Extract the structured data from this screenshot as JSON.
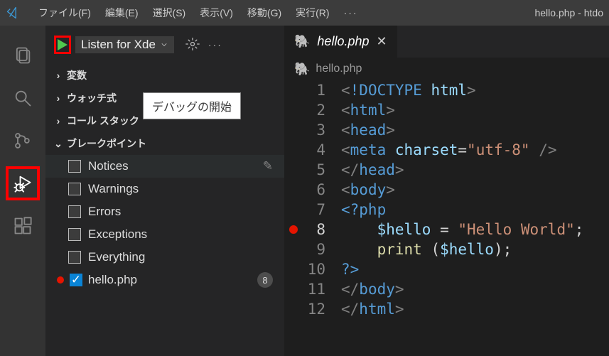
{
  "window_title": "hello.php - htdo",
  "menubar": [
    "ファイル(F)",
    "編集(E)",
    "選択(S)",
    "表示(V)",
    "移動(G)",
    "実行(R)"
  ],
  "sidebar": {
    "config_label": "Listen for Xde",
    "tooltip": "デバッグの開始",
    "sections": {
      "variables": "変数",
      "watch": "ウォッチ式",
      "callstack": "コール スタック",
      "breakpoints": "ブレークポイント"
    },
    "breakpoints": [
      {
        "label": "Notices",
        "checked": false
      },
      {
        "label": "Warnings",
        "checked": false
      },
      {
        "label": "Errors",
        "checked": false
      },
      {
        "label": "Exceptions",
        "checked": false
      },
      {
        "label": "Everything",
        "checked": false
      }
    ],
    "file_bp": {
      "label": "hello.php",
      "count": "8"
    }
  },
  "editor": {
    "tab_label": "hello.php",
    "breadcrumb": "hello.php",
    "breakpoint_line": 8,
    "current_line": 8,
    "lines": [
      {
        "n": 1,
        "tokens": [
          [
            "<",
            "ang"
          ],
          [
            "!DOCTYPE ",
            "tag"
          ],
          [
            "html",
            "attr"
          ],
          [
            ">",
            "ang"
          ]
        ]
      },
      {
        "n": 2,
        "tokens": [
          [
            "<",
            "ang"
          ],
          [
            "html",
            "tag"
          ],
          [
            ">",
            "ang"
          ]
        ]
      },
      {
        "n": 3,
        "tokens": [
          [
            "<",
            "ang"
          ],
          [
            "head",
            "tag"
          ],
          [
            ">",
            "ang"
          ]
        ]
      },
      {
        "n": 4,
        "tokens": [
          [
            "<",
            "ang"
          ],
          [
            "meta ",
            "tag"
          ],
          [
            "charset",
            "attr"
          ],
          [
            "=",
            "txt"
          ],
          [
            "\"utf-8\"",
            "str"
          ],
          [
            " />",
            "ang"
          ]
        ]
      },
      {
        "n": 5,
        "tokens": [
          [
            "</",
            "ang"
          ],
          [
            "head",
            "tag"
          ],
          [
            ">",
            "ang"
          ]
        ]
      },
      {
        "n": 6,
        "tokens": [
          [
            "<",
            "ang"
          ],
          [
            "body",
            "tag"
          ],
          [
            ">",
            "ang"
          ]
        ]
      },
      {
        "n": 7,
        "tokens": [
          [
            "<?php",
            "tag"
          ]
        ]
      },
      {
        "n": 8,
        "tokens": [
          [
            "    ",
            "txt"
          ],
          [
            "$hello",
            "var"
          ],
          [
            " = ",
            "txt"
          ],
          [
            "\"Hello World\"",
            "str"
          ],
          [
            ";",
            "txt"
          ]
        ]
      },
      {
        "n": 9,
        "tokens": [
          [
            "    ",
            "txt"
          ],
          [
            "print",
            "fun"
          ],
          [
            " (",
            "txt"
          ],
          [
            "$hello",
            "var"
          ],
          [
            ");",
            "txt"
          ]
        ]
      },
      {
        "n": 10,
        "tokens": [
          [
            "?>",
            "tag"
          ]
        ]
      },
      {
        "n": 11,
        "tokens": [
          [
            "</",
            "ang"
          ],
          [
            "body",
            "tag"
          ],
          [
            ">",
            "ang"
          ]
        ]
      },
      {
        "n": 12,
        "tokens": [
          [
            "</",
            "ang"
          ],
          [
            "html",
            "tag"
          ],
          [
            ">",
            "ang"
          ]
        ]
      }
    ]
  }
}
